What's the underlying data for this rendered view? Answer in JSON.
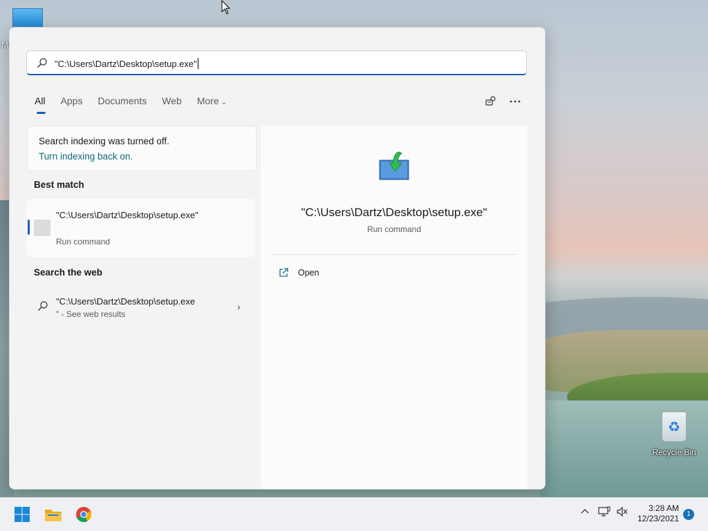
{
  "desktop": {
    "partial_icon_letter": "M",
    "recycle_bin_label": "Recycle Bin"
  },
  "search": {
    "query": "\"C:\\Users\\Dartz\\Desktop\\setup.exe\""
  },
  "tabs": [
    {
      "label": "All",
      "active": true
    },
    {
      "label": "Apps"
    },
    {
      "label": "Documents"
    },
    {
      "label": "Web"
    },
    {
      "label": "More"
    }
  ],
  "toolbar_icons": [
    "share-search-icon",
    "more-options-icon"
  ],
  "notice": {
    "message": "Search indexing was turned off.",
    "link": "Turn indexing back on."
  },
  "sections": {
    "best_match": "Best match",
    "search_web": "Search the web"
  },
  "best_match": {
    "title": "\"C:\\Users\\Dartz\\Desktop\\setup.exe\"",
    "subtitle": "Run command"
  },
  "web_result": {
    "title": "\"C:\\Users\\Dartz\\Desktop\\setup.exe",
    "subtitle_prefix": "\"",
    "subtitle": " - See web results"
  },
  "preview": {
    "title": "\"C:\\Users\\Dartz\\Desktop\\setup.exe\"",
    "subtitle": "Run command",
    "actions": [
      {
        "label": "Open",
        "icon": "open-external-icon"
      }
    ]
  },
  "taskbar": {
    "apps": [
      "windows-start-icon",
      "file-explorer-icon",
      "chrome-icon"
    ],
    "tray_icons": [
      "chevron-up-icon",
      "network-icon",
      "volume-muted-icon"
    ],
    "time": "3:28 AM",
    "date": "12/23/2021",
    "notification_count": "1"
  },
  "colors": {
    "accent": "#1a5fb4",
    "link": "#0f6a7d",
    "panel_bg": "#f3f3f3"
  }
}
